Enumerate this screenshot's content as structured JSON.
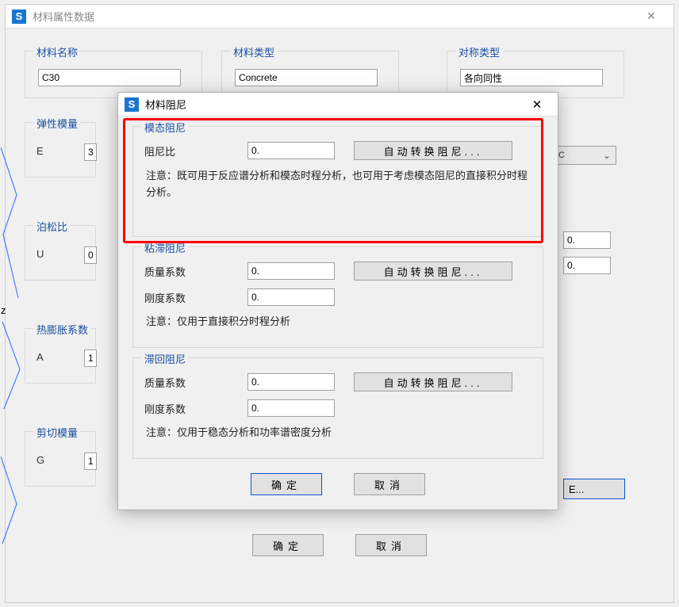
{
  "colors": {
    "accent": "#1a4fa0",
    "highlight": "#ff0000",
    "primaryBtn": "#0b57d0"
  },
  "bgWindow": {
    "title": "材料属性数据",
    "close": "✕",
    "groups": {
      "name": {
        "legend": "材料名称",
        "value": "C30"
      },
      "type": {
        "legend": "材料类型",
        "value": "Concrete"
      },
      "symm": {
        "legend": "对称类型",
        "value": "各向同性"
      },
      "elastic": {
        "legend": "弹性模量",
        "label": "E",
        "valuePrefix": "3",
        "unit": "C"
      },
      "poisson": {
        "legend": "泊松比",
        "label": "U",
        "valuePrefix": "0"
      },
      "thermal": {
        "legend": "热膨胀系数",
        "label": "A",
        "valuePrefix": "1"
      },
      "shear": {
        "legend": "剪切模量",
        "label": "G",
        "valuePrefix": "1"
      }
    },
    "rightDots": {
      "v1": "0.",
      "v2": "0."
    },
    "tailBtn": "E...",
    "ok": "确定",
    "cancel": "取消"
  },
  "modal": {
    "title": "材料阻尼",
    "close": "✕",
    "groups": {
      "modal": {
        "legend": "模态阻尼",
        "ratioLabel": "阻尼比",
        "ratioValue": "0.",
        "autoBtn": "自动转换阻尼...",
        "note": "注意：既可用于反应谱分析和模态时程分析，也可用于考虑模态阻尼的直接积分时程分析。"
      },
      "viscous": {
        "legend": "粘滞阻尼",
        "massLabel": "质量系数",
        "massValue": "0.",
        "stiffLabel": "刚度系数",
        "stiffValue": "0.",
        "autoBtn": "自动转换阻尼...",
        "note": "注意：仅用于直接积分时程分析"
      },
      "hysteretic": {
        "legend": "滞回阻尼",
        "massLabel": "质量系数",
        "massValue": "0.",
        "stiffLabel": "刚度系数",
        "stiffValue": "0.",
        "autoBtn": "自动转换阻尼...",
        "note": "注意：仅用于稳态分析和功率谱密度分析"
      }
    },
    "ok": "确定",
    "cancel": "取消"
  }
}
